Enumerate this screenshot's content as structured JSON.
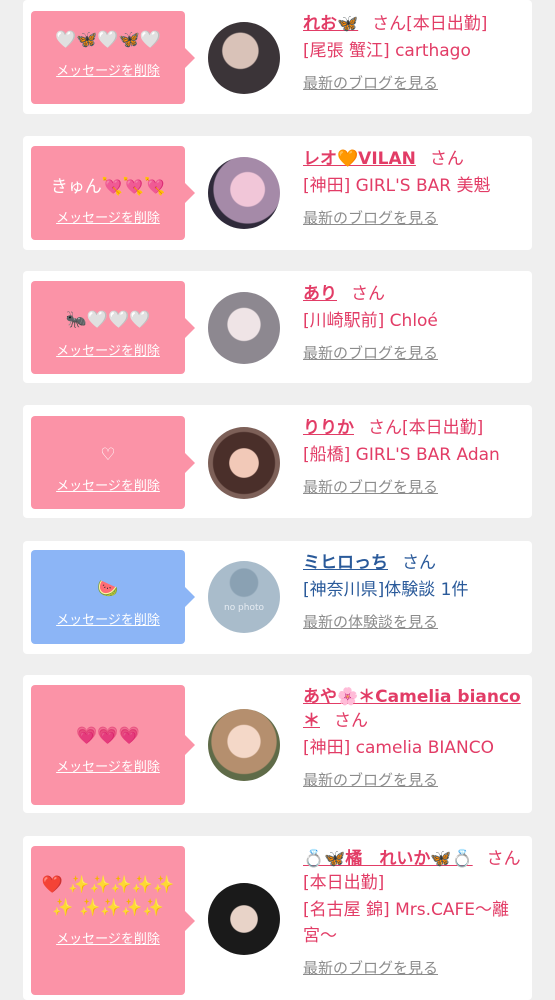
{
  "colors": {
    "page_bg": "#efefef",
    "bubble_pink": "#fb93a7",
    "bubble_blue": "#8cb5f6",
    "text_pink": "#e23c66",
    "text_blue": "#2a5a9a",
    "link_gray": "#8c8c8c"
  },
  "items": [
    {
      "message": "🤍🦋🤍🦋🤍",
      "delete_label": "メッセージを削除",
      "name": "れお🦋",
      "honorific": "さん[本日出勤]",
      "shop": "[尾張 蟹江] carthago",
      "link": "最新のブログを見る",
      "avatar_icon": "profile-photo"
    },
    {
      "message": "きゅん💘💘💘",
      "delete_label": "メッセージを削除",
      "name": "レオ🧡VILAN",
      "honorific": "さん",
      "shop": "[神田] GIRL'S BAR 美魁",
      "link": "最新のブログを見る",
      "avatar_icon": "profile-photo"
    },
    {
      "message": "🐜🤍🤍🤍",
      "delete_label": "メッセージを削除",
      "name": "あり",
      "honorific": "さん",
      "shop": "[川崎駅前] Chloé",
      "link": "最新のブログを見る",
      "avatar_icon": "profile-photo"
    },
    {
      "message": "♡",
      "delete_label": "メッセージを削除",
      "name": "りりか",
      "honorific": "さん[本日出勤]",
      "shop": "[船橋] GIRL'S BAR Adan",
      "link": "最新のブログを見る",
      "avatar_icon": "profile-photo"
    },
    {
      "message": "🍉",
      "delete_label": "メッセージを削除",
      "name": "ミヒロっち",
      "honorific": "さん",
      "shop": "[神奈川県]体験談 1件",
      "link": "最新の体験談を見る",
      "avatar_icon": "no-photo-silhouette",
      "avatar_text": "no photo"
    },
    {
      "message": "💗💗💗",
      "delete_label": "メッセージを削除",
      "name": "あや🌸＊Camelia bianco＊",
      "honorific": "さん",
      "shop": "[神田] camelia BIANCO",
      "link": "最新のブログを見る",
      "avatar_icon": "profile-photo"
    },
    {
      "message": "❤️ ✨✨✨✨✨✨ ✨✨✨✨",
      "delete_label": "メッセージを削除",
      "name": "💍🦋橘　れいか🦋💍",
      "honorific": "さん[本日出勤]",
      "shop": "[名古屋 錦] Mrs.CAFE〜離宮〜",
      "link": "最新のブログを見る",
      "avatar_icon": "profile-photo"
    }
  ]
}
